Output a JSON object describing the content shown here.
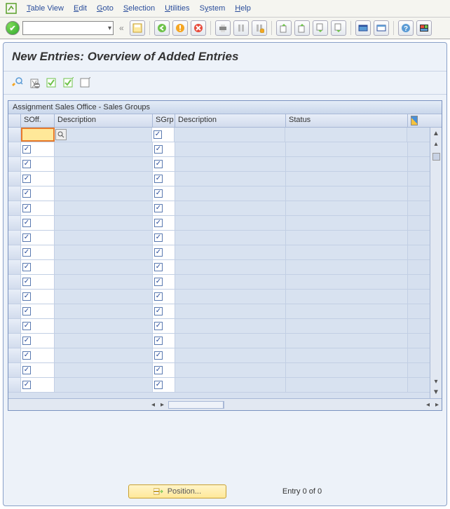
{
  "menu": {
    "table_view": "Table View",
    "edit": "Edit",
    "goto": "Goto",
    "selection": "Selection",
    "utilities": "Utilities",
    "system": "System",
    "help": "Help"
  },
  "title": "New Entries: Overview of Added Entries",
  "table": {
    "caption": "Assignment Sales Office - Sales Groups",
    "columns": {
      "soff": "SOff.",
      "desc": "Description",
      "sgrp": "SGrp",
      "desc2": "Description",
      "status": "Status"
    }
  },
  "footer": {
    "position_btn": "Position...",
    "entry_text": "Entry 0 of 0"
  },
  "row_count": 18
}
